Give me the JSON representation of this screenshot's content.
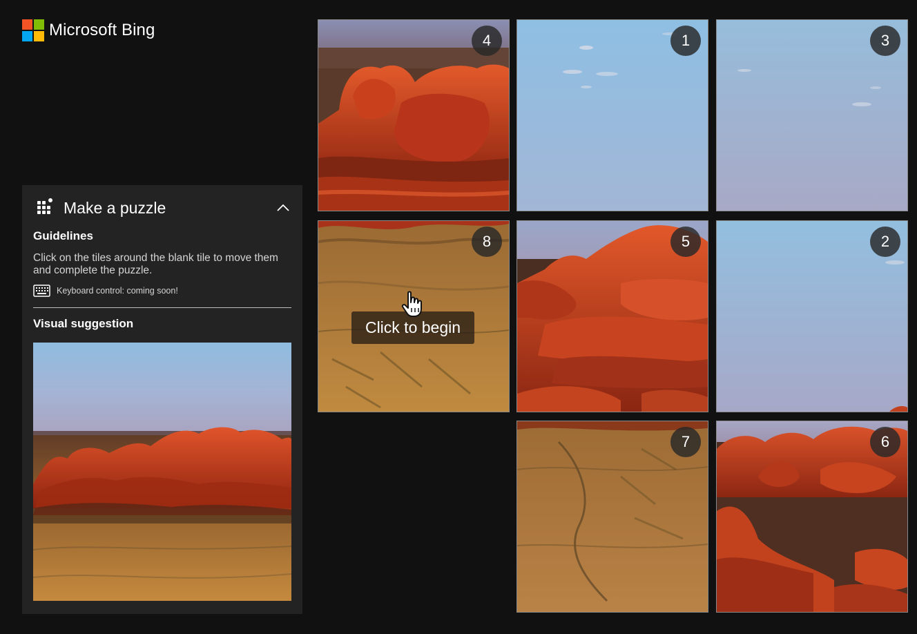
{
  "brand": {
    "name": "Microsoft Bing",
    "logo_colors": [
      "#f35325",
      "#81bc06",
      "#05a6f0",
      "#ffba08"
    ]
  },
  "panel": {
    "title": "Make a puzzle",
    "title_icon": "puzzle-grid-icon",
    "collapse_icon": "chevron-up-icon",
    "guidelines_heading": "Guidelines",
    "guidelines_text": "Click on the tiles around the blank tile to move them and complete the puzzle.",
    "keyboard_icon": "keyboard-icon",
    "keyboard_text": "Keyboard control: coming soon!",
    "visual_heading": "Visual suggestion"
  },
  "puzzle": {
    "overlay_text": "Click to begin",
    "cursor_icon": "hand-pointer-icon",
    "tiles": [
      {
        "slot": 0,
        "number": "4",
        "scene": "rocks-top"
      },
      {
        "slot": 1,
        "number": "1",
        "scene": "sky"
      },
      {
        "slot": 2,
        "number": "3",
        "scene": "sky"
      },
      {
        "slot": 3,
        "number": "8",
        "scene": "desert"
      },
      {
        "slot": 4,
        "number": "5",
        "scene": "rocks-mid"
      },
      {
        "slot": 5,
        "number": "2",
        "scene": "sky"
      },
      {
        "slot": 6,
        "number": "",
        "scene": "blank"
      },
      {
        "slot": 7,
        "number": "7",
        "scene": "desert"
      },
      {
        "slot": 8,
        "number": "6",
        "scene": "rocks-low"
      }
    ]
  },
  "colors": {
    "background": "#111111",
    "panel": "#232323",
    "sky_top": "#93bfdf",
    "sky_bottom": "#a8a9c9",
    "rock": "#d2401c",
    "desert": "#b87a35"
  }
}
